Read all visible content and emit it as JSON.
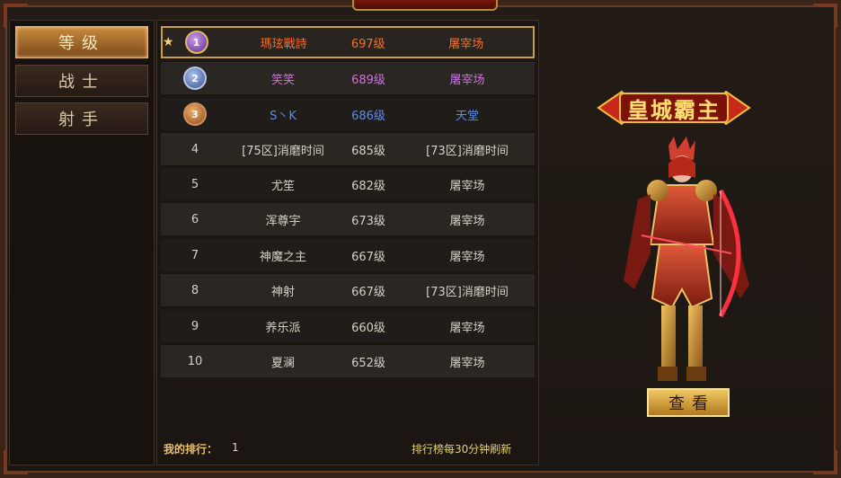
{
  "categories": [
    {
      "label": "等级"
    },
    {
      "label": "战士"
    },
    {
      "label": "射手"
    }
  ],
  "rankings": [
    {
      "rank": "1",
      "medal": "gold-medal-icon",
      "name": "瑪玹戰詩",
      "level": "697级",
      "server": "屠宰场",
      "name_color": "#f07030",
      "level_color": "#f07030",
      "server_color": "#f07030"
    },
    {
      "rank": "2",
      "medal": "silver-medal-icon",
      "name": "笑笑",
      "level": "689级",
      "server": "屠宰场",
      "name_color": "#d070e0",
      "level_color": "#d070e0",
      "server_color": "#d070e0"
    },
    {
      "rank": "3",
      "medal": "bronze-medal-icon",
      "name": "S丶K",
      "level": "686级",
      "server": "天堂",
      "name_color": "#5a8cf0",
      "level_color": "#5a8cf0",
      "server_color": "#5a8cf0"
    },
    {
      "rank": "4",
      "name": "[75区]消磨时间",
      "level": "685级",
      "server": "[73区]消磨时间"
    },
    {
      "rank": "5",
      "name": "尤笙",
      "level": "682级",
      "server": "屠宰场"
    },
    {
      "rank": "6",
      "name": "浑尊宇",
      "level": "673级",
      "server": "屠宰场"
    },
    {
      "rank": "7",
      "name": "神魔之主",
      "level": "667级",
      "server": "屠宰场"
    },
    {
      "rank": "8",
      "name": "神射",
      "level": "667级",
      "server": "[73区]消磨时间"
    },
    {
      "rank": "9",
      "name": "养乐派",
      "level": "660级",
      "server": "屠宰场"
    },
    {
      "rank": "10",
      "name": "夏澜",
      "level": "652级",
      "server": "屠宰场"
    }
  ],
  "footer": {
    "my_rank_label": "我的排行：",
    "my_rank_value": "1",
    "refresh_note": "排行榜每30分钟刷新"
  },
  "champion": {
    "title": "皇城霸主",
    "view_button": "查看"
  },
  "colors": {
    "accent": "#c98a3c",
    "frame": "#3a2418"
  }
}
